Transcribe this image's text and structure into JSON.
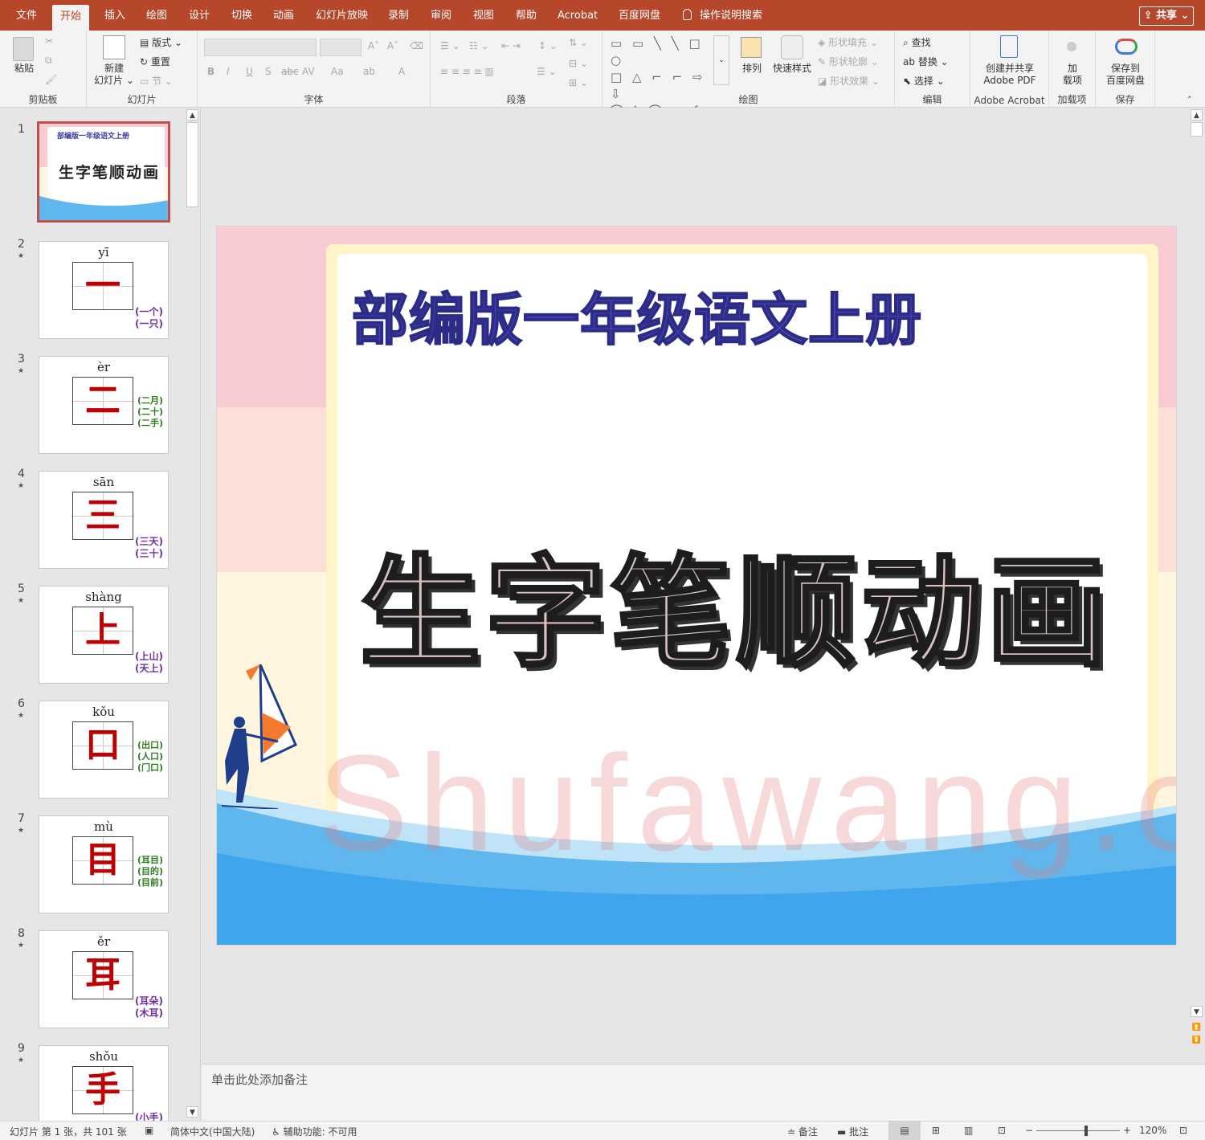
{
  "tabs": [
    "文件",
    "开始",
    "插入",
    "绘图",
    "设计",
    "切换",
    "动画",
    "幻灯片放映",
    "录制",
    "审阅",
    "视图",
    "帮助",
    "Acrobat",
    "百度网盘"
  ],
  "active_tab": "开始",
  "tell_me": "操作说明搜索",
  "share": "共享",
  "ribbon": {
    "clipboard": {
      "paste": "粘贴",
      "label": "剪贴板"
    },
    "slides": {
      "new_slide": "新建",
      "new_slide2": "幻灯片",
      "layout": "版式",
      "reset": "重置",
      "section": "节",
      "label": "幻灯片"
    },
    "font": {
      "label": "字体",
      "bold": "B",
      "italic": "I",
      "underline": "U",
      "shadow": "S",
      "strike": "abc",
      "spacing": "AV",
      "case": "Aa",
      "color": "A"
    },
    "paragraph": {
      "label": "段落"
    },
    "drawing": {
      "arrange": "排列",
      "quick_styles": "快速样式",
      "shape_fill": "形状填充",
      "shape_outline": "形状轮廓",
      "shape_effects": "形状效果",
      "label": "绘图"
    },
    "editing": {
      "find": "查找",
      "replace": "替换",
      "select": "选择",
      "label": "编辑"
    },
    "acrobat": {
      "create1": "创建并共享",
      "create2": "Adobe PDF",
      "label": "Adobe Acrobat"
    },
    "addins": {
      "addin1": "加",
      "addin2": "载项",
      "label": "加载项"
    },
    "save": {
      "save1": "保存到",
      "save2": "百度网盘",
      "label": "保存"
    }
  },
  "thumbnails": [
    {
      "num": "1",
      "subtitle": "部编版一年级语文上册",
      "title": "生字笔顺动画"
    },
    {
      "num": "2",
      "pinyin": "yī",
      "char": "一",
      "words": [
        "(一个)",
        "(一只)"
      ],
      "color": "purple"
    },
    {
      "num": "3",
      "pinyin": "èr",
      "char": "二",
      "words": [
        "(二月)",
        "(二十)",
        "(二手)"
      ],
      "color": "green"
    },
    {
      "num": "4",
      "pinyin": "sān",
      "char": "三",
      "words": [
        "(三天)",
        "(三十)"
      ],
      "color": "purple"
    },
    {
      "num": "5",
      "pinyin": "shàng",
      "char": "上",
      "words": [
        "(上山)",
        "(天上)"
      ],
      "color": "purple"
    },
    {
      "num": "6",
      "pinyin": "kǒu",
      "char": "口",
      "words": [
        "(出口)",
        "(人口)",
        "(门口)"
      ],
      "color": "green"
    },
    {
      "num": "7",
      "pinyin": "mù",
      "char": "目",
      "words": [
        "(耳目)",
        "(目的)",
        "(目前)"
      ],
      "color": "green"
    },
    {
      "num": "8",
      "pinyin": "ěr",
      "char": "耳",
      "words": [
        "(耳朵)",
        "(木耳)"
      ],
      "color": "purple"
    },
    {
      "num": "9",
      "pinyin": "shǒu",
      "char": "手",
      "words": [
        "(小手)"
      ],
      "color": "purple"
    }
  ],
  "slide": {
    "subtitle": "部编版一年级语文上册",
    "title": "生字笔顺动画",
    "watermark": "Shufawang.cn"
  },
  "notes_placeholder": "单击此处添加备注",
  "status": {
    "slide_info": "幻灯片 第 1 张，共 101 张",
    "language": "简体中文(中国大陆)",
    "accessibility": "辅助功能: 不可用",
    "notes": "备注",
    "comments": "批注",
    "zoom": "120%",
    "zoom_level": 0.6
  }
}
